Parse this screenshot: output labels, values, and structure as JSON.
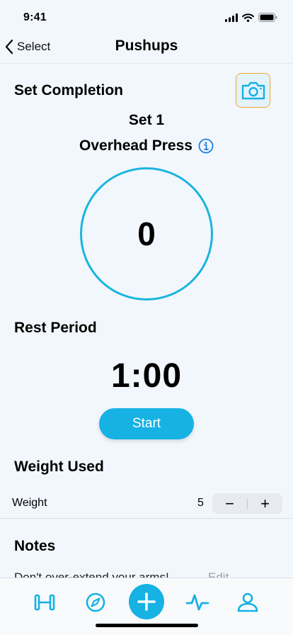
{
  "status_bar": {
    "time": "9:41"
  },
  "nav": {
    "back_label": "Select",
    "title": "Pushups"
  },
  "set_completion": {
    "title": "Set Completion",
    "set_label": "Set 1",
    "exercise": "Overhead Press",
    "count": "0"
  },
  "rest_period": {
    "title": "Rest Period",
    "timer": "1:00",
    "start_label": "Start"
  },
  "weight_used": {
    "title": "Weight Used",
    "row_label": "Weight",
    "value": "5",
    "decrement": "−",
    "increment": "+"
  },
  "notes": {
    "title": "Notes",
    "text": "Don't over-extend your arms!",
    "edit_label": "Edit"
  },
  "tab_bar": {
    "items": [
      {
        "icon": "dumbbell-icon"
      },
      {
        "icon": "compass-icon"
      },
      {
        "icon": "add-icon"
      },
      {
        "icon": "activity-pulse-icon"
      },
      {
        "icon": "profile-icon"
      }
    ]
  },
  "colors": {
    "accent": "#15b2e3",
    "circle": "#19b5dd",
    "camera_border": "#f0a82a",
    "background": "#f2f7fd"
  }
}
